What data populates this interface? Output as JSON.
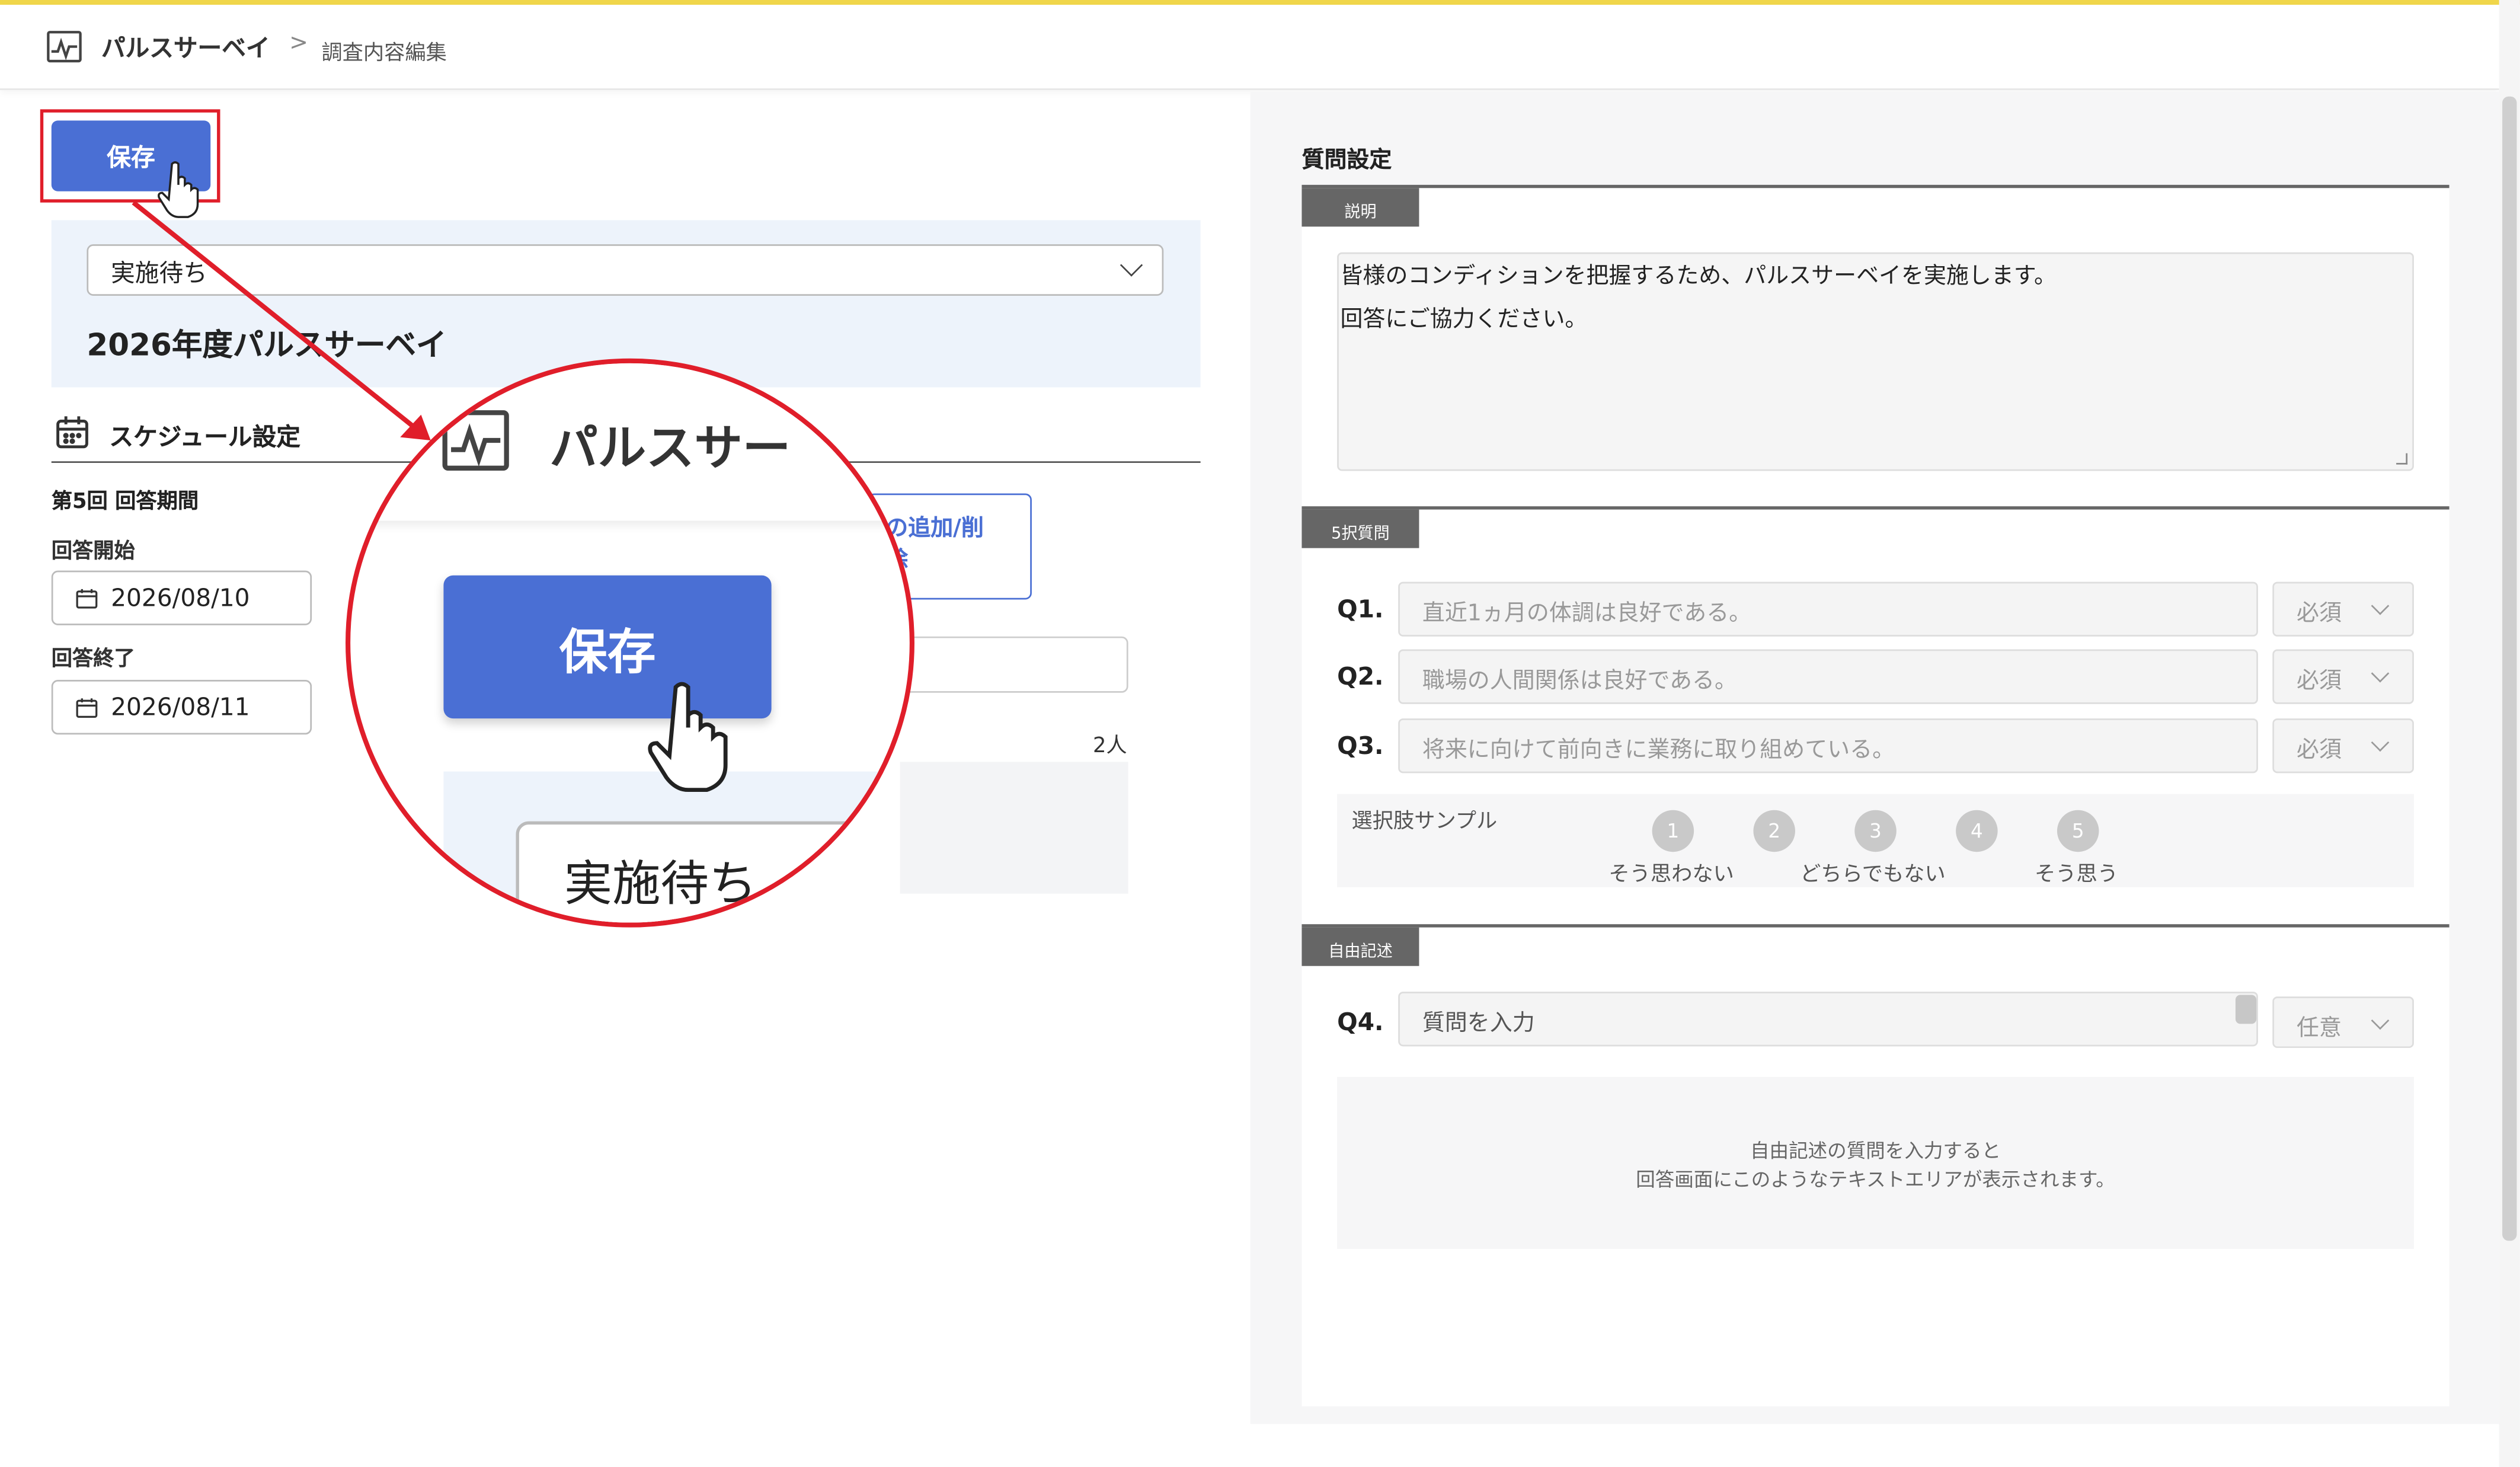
{
  "header": {
    "app_name": "パルスサーベイ",
    "separator": ">",
    "breadcrumb": "調査内容編集"
  },
  "left": {
    "save_label": "保存",
    "status_value": "実施待ち",
    "survey_title": "2026年度パルスサーベイ",
    "schedule_title": "スケジュール設定",
    "period_label": "第5回 回答期間",
    "start_label": "回答開始",
    "start_date": "2026/08/10",
    "end_label": "回答終了",
    "end_date": "2026/08/11",
    "partial_button": "の追加/削",
    "partial_button_tail": "除",
    "count": "2人"
  },
  "zoom": {
    "app_name": "パルスサー",
    "save_label": "保存",
    "status_value": "実施待ち"
  },
  "right": {
    "section_title": "質問設定",
    "desc_tag": "説明",
    "description_lines": [
      "皆様のコンディションを把握するため、パルスサーベイを実施します。",
      "回答にご協力ください。"
    ],
    "choice_tag": "5択質問",
    "questions": [
      {
        "label": "Q1.",
        "text": "直近1ヵ月の体調は良好である。",
        "required": "必須"
      },
      {
        "label": "Q2.",
        "text": "職場の人間関係は良好である。",
        "required": "必須"
      },
      {
        "label": "Q3.",
        "text": "将来に向けて前向きに業務に取り組めている。",
        "required": "必須"
      }
    ],
    "sample_title": "選択肢サンプル",
    "options": [
      "1",
      "2",
      "3",
      "4",
      "5"
    ],
    "option_labels": [
      "そう思わない",
      "どちらでもない",
      "そう思う"
    ],
    "free_tag": "自由記述",
    "free_question": {
      "label": "Q4.",
      "placeholder": "質問を入力",
      "required": "任意"
    },
    "free_note_lines": [
      "自由記述の質問を入力すると",
      "回答画面にこのようなテキストエリアが表示されます。"
    ]
  },
  "colors": {
    "accent": "#4a6fd4",
    "highlight": "#e01e2a",
    "header_line": "#f0d64a",
    "status_bg": "#edf3fb"
  }
}
